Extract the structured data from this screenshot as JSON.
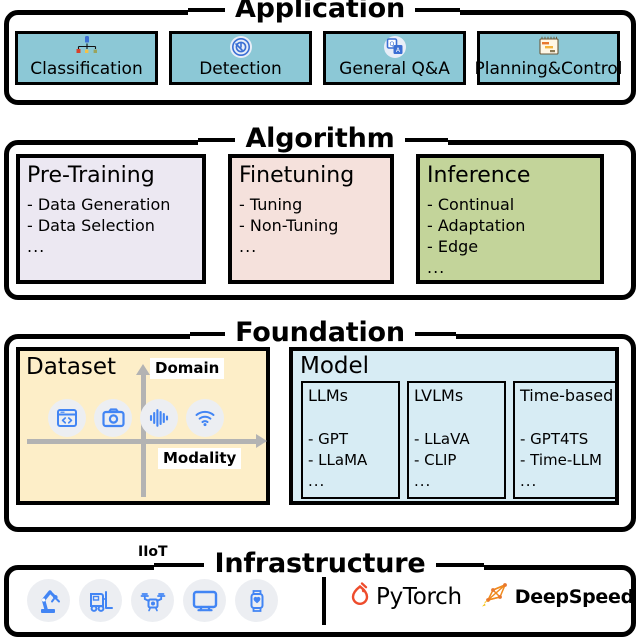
{
  "sections": [
    {
      "id": "application",
      "title": "Application",
      "cards": [
        {
          "label": "Classification",
          "icon": "classification-tree-icon"
        },
        {
          "label": "Detection",
          "icon": "detection-target-icon"
        },
        {
          "label": "General Q&A",
          "icon": "qa-chat-icon"
        },
        {
          "label": "Planning&Control",
          "icon": "planning-gantt-icon"
        }
      ]
    },
    {
      "id": "algorithm",
      "title": "Algorithm",
      "cards": [
        {
          "title": "Pre-Training",
          "items": [
            "- Data Generation",
            "- Data Selection"
          ],
          "dots": "...",
          "color": "#ece8f2"
        },
        {
          "title": "Finetuning",
          "items": [
            "- Tuning",
            "- Non-Tuning"
          ],
          "dots": "...",
          "color": "#f5e1dc"
        },
        {
          "title": "Inference",
          "items": [
            "- Continual",
            "- Adaptation",
            "- Edge"
          ],
          "dots": "...",
          "color": "#c3d49a"
        }
      ]
    },
    {
      "id": "foundation",
      "title": "Foundation",
      "dataset": {
        "title": "Dataset",
        "y_axis_label": "Domain",
        "x_axis_label": "Modality",
        "color": "#fdeec8",
        "icons": [
          "code-window-icon",
          "camera-icon",
          "audio-waveform-icon",
          "wifi-signal-icon"
        ]
      },
      "model": {
        "title": "Model",
        "color": "#d7ecf4",
        "columns": [
          {
            "title": "LLMs",
            "items": [
              "- GPT",
              "- LLaMA"
            ],
            "dots": "..."
          },
          {
            "title": "LVLMs",
            "items": [
              "- LLaVA",
              "- CLIP"
            ],
            "dots": "..."
          },
          {
            "title": "Time-based",
            "items": [
              "- GPT4TS",
              "- Time-LLM"
            ],
            "dots": "..."
          }
        ]
      }
    },
    {
      "id": "infrastructure",
      "title": "Infrastructure",
      "iiot": {
        "label": "IIoT",
        "icons": [
          "robot-arm-icon",
          "forklift-icon",
          "drone-icon",
          "monitor-icon",
          "smartwatch-icon"
        ]
      },
      "vendors": [
        {
          "name": "PyTorch",
          "logo": "pytorch-flame-icon",
          "color": "#ee4c2c"
        },
        {
          "name": "DeepSpeed",
          "logo": "deepspeed-rocket-icon",
          "color": "#f5a623"
        }
      ],
      "more": "···"
    }
  ],
  "palette": {
    "application_card": "#8cc8d6",
    "pretraining": "#ece8f2",
    "finetuning": "#f5e1dc",
    "inference": "#c3d49a",
    "dataset": "#fdeec8",
    "model": "#d7ecf4",
    "icon_blue": "#4285f4",
    "icon_circle": "#eceef2",
    "axis_gray": "#b3b3b3"
  }
}
